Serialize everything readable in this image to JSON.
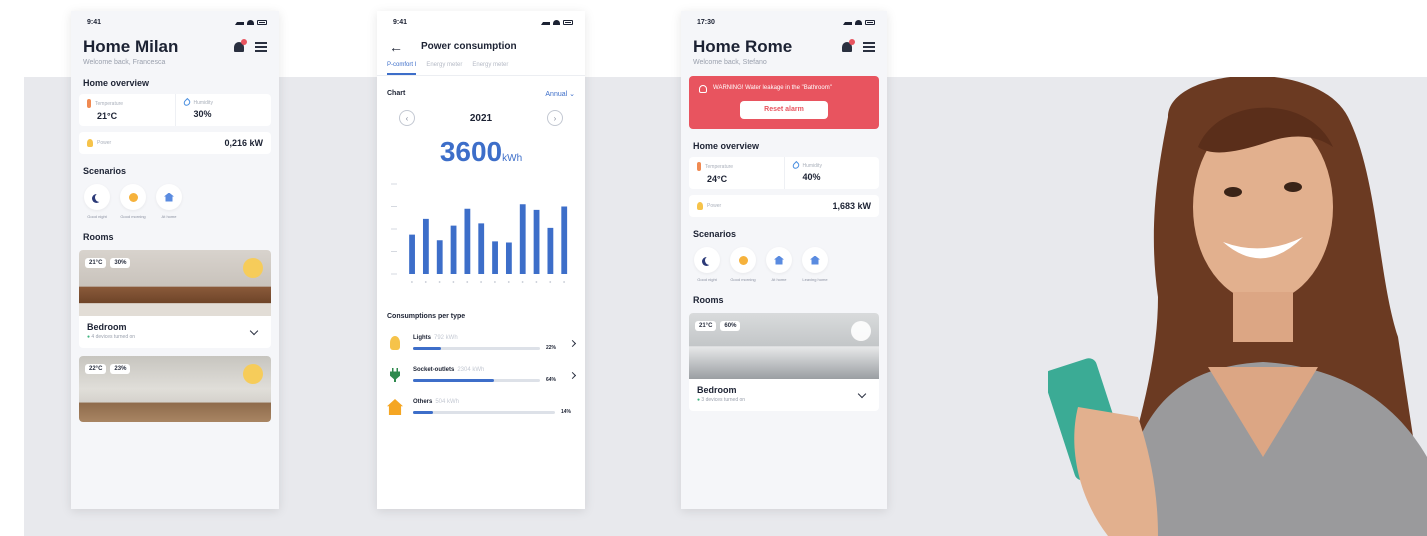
{
  "phone1": {
    "time": "9:41",
    "title": "Home Milan",
    "subtitle": "Welcome back, Francesca",
    "overview_title": "Home overview",
    "temperature_label": "Temperature",
    "temperature": "21°C",
    "humidity_label": "Humidity",
    "humidity": "30%",
    "power_label": "Power",
    "power": "0,216 kW",
    "scenarios_title": "Scenarios",
    "scenarios": [
      "Good night",
      "Good morning",
      "At home"
    ],
    "rooms_title": "Rooms",
    "rooms": [
      {
        "temp": "21°C",
        "hum": "30%",
        "name": "Bedroom",
        "status": "4 devices turned on"
      },
      {
        "temp": "22°C",
        "hum": "23%",
        "name": "",
        "status": ""
      }
    ]
  },
  "phone2": {
    "time": "9:41",
    "title": "Power consumption",
    "tabs": [
      "P-comfort I",
      "Energy meter",
      "Energy meter"
    ],
    "chart_label": "Chart",
    "period": "Annual",
    "year": "2021",
    "total_value": "3600",
    "total_unit": "kWh",
    "types_title": "Consumptions per type",
    "types": [
      {
        "name": "Lights",
        "kwh": "792 kWh",
        "percent": "22%",
        "fraction": 0.22
      },
      {
        "name": "Socket-outlets",
        "kwh": "2304 kWh",
        "percent": "64%",
        "fraction": 0.64
      },
      {
        "name": "Others",
        "kwh": "504 kWh",
        "percent": "14%",
        "fraction": 0.14
      }
    ]
  },
  "phone3": {
    "time": "17:30",
    "title": "Home Rome",
    "subtitle": "Welcome back, Stefano",
    "alarm_text": "WARNING! Water leakage in the \"Bathroom\"",
    "alarm_button": "Reset alarm",
    "overview_title": "Home overview",
    "temperature_label": "Temperature",
    "temperature": "24°C",
    "humidity_label": "Humidity",
    "humidity": "40%",
    "power_label": "Power",
    "power": "1,683 kW",
    "scenarios_title": "Scenarios",
    "scenarios": [
      "Good night",
      "Good morning",
      "At home",
      "Leaving home"
    ],
    "rooms_title": "Rooms",
    "room": {
      "temp": "21°C",
      "hum": "60%",
      "name": "Bedroom",
      "status": "3 devices turned on"
    }
  },
  "colors": {
    "accent": "#3d6ec9",
    "alarm": "#e8545f",
    "background_band": "#e8e9ed"
  },
  "chart_data": {
    "type": "bar",
    "categories": [
      "",
      "",
      "",
      "",
      "",
      "",
      "",
      "",
      "",
      "",
      "",
      "",
      "",
      "",
      "",
      "",
      "",
      "",
      "",
      "",
      "",
      "",
      "",
      ""
    ],
    "values": [
      175,
      245,
      150,
      215,
      290,
      225,
      145,
      140,
      310,
      285,
      205,
      300
    ],
    "ylim": [
      0,
      400
    ],
    "grid": false,
    "xlabel": "",
    "ylabel": ""
  }
}
